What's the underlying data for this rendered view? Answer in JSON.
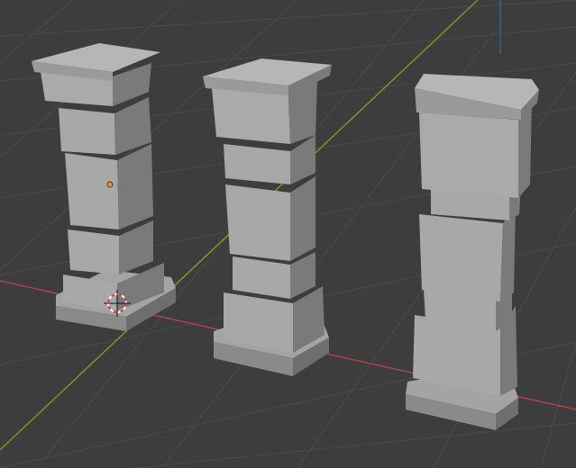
{
  "viewport": {
    "background": "#3d3d3d",
    "grid_color": "#4a4a4a",
    "x_axis_color": "#b04050",
    "y_axis_color": "#6f9a2d",
    "z_axis_color": "#3f6fa0"
  },
  "scene": {
    "objects": [
      {
        "name": "pillar-left",
        "selected": true
      },
      {
        "name": "pillar-middle",
        "selected": false
      },
      {
        "name": "pillar-right",
        "selected": false
      }
    ],
    "origin_dot_color": "#f0902a",
    "cursor_colors": {
      "ring_a": "#e04040",
      "ring_b": "#ffffff"
    },
    "stone_colors": {
      "light": "#b6b6b6",
      "mid": "#a4a4a4",
      "dark": "#8a8a8a",
      "shadow": "#6e6e6e"
    }
  },
  "icons": {
    "cursor": "3d-cursor-icon",
    "origin": "object-origin-icon"
  }
}
